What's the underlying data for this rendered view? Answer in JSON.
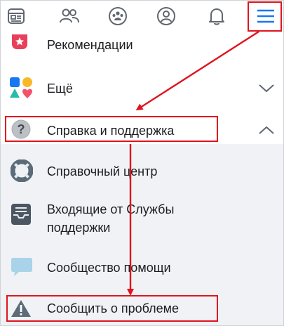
{
  "nav": {
    "items": [
      {
        "name": "feed-icon"
      },
      {
        "name": "friends-icon"
      },
      {
        "name": "groups-icon"
      },
      {
        "name": "profile-icon"
      },
      {
        "name": "notifications-bell-icon"
      },
      {
        "name": "hamburger-menu-icon"
      }
    ]
  },
  "menu": {
    "recommendations": "Рекомендации",
    "more": "Ещё",
    "help_support": "Справка и поддержка",
    "help_center": "Справочный центр",
    "support_inbox": "Входящие от Службы поддержки",
    "support_inbox_line1": "Входящие от Службы",
    "support_inbox_line2": "поддержки",
    "help_community": "Сообщество помощи",
    "report_problem": "Сообщить о проблеме"
  },
  "colors": {
    "annotation_red": "#e0141e",
    "accent_blue": "#1877f2"
  }
}
